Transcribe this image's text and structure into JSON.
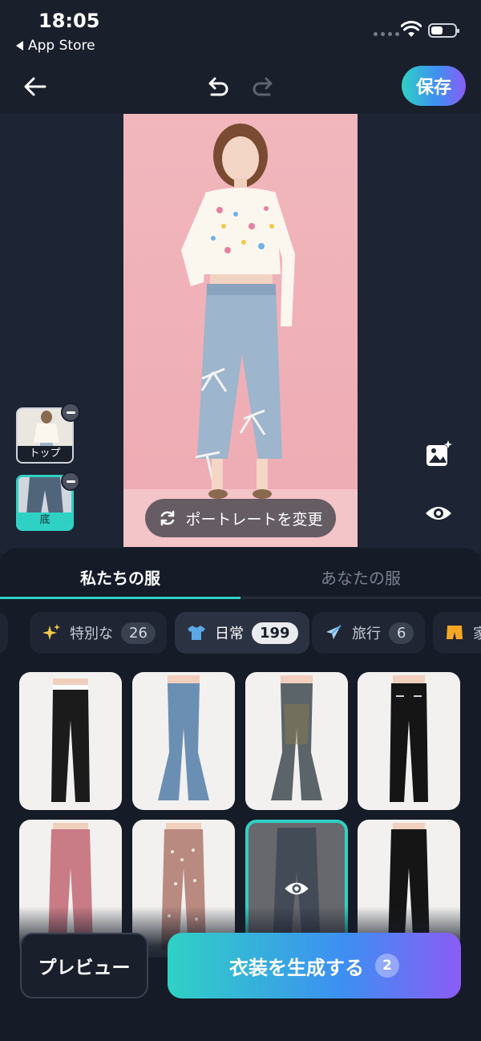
{
  "status_bar": {
    "time": "18:05",
    "back_app": "App Store"
  },
  "header": {
    "save_label": "保存"
  },
  "editor": {
    "change_portrait_label": "ポートレートを変更",
    "layers": [
      {
        "label": "トップ",
        "active": false
      },
      {
        "label": "底",
        "active": true
      }
    ]
  },
  "tabs": [
    {
      "label": "私たちの服",
      "active": true
    },
    {
      "label": "あなたの服",
      "active": false
    }
  ],
  "categories": [
    {
      "label": "特別な",
      "count": "26",
      "icon": "sparkles-icon",
      "selected": false
    },
    {
      "label": "日常",
      "count": "199",
      "icon": "tshirt-icon",
      "selected": true
    },
    {
      "label": "旅行",
      "count": "6",
      "icon": "airplane-icon",
      "selected": false
    },
    {
      "label": "家",
      "count": "",
      "icon": "shorts-icon",
      "selected": false
    }
  ],
  "outfits": [
    {
      "name": "black-wide-pants",
      "selected": false
    },
    {
      "name": "blue-flare-jeans",
      "selected": false
    },
    {
      "name": "gray-flare-jeans",
      "selected": false
    },
    {
      "name": "black-zip-pants",
      "selected": false
    },
    {
      "name": "pink-straight-pants",
      "selected": false
    },
    {
      "name": "dot-print-pants",
      "selected": false
    },
    {
      "name": "ribbon-denim",
      "selected": true
    },
    {
      "name": "black-high-waist-pants",
      "selected": false
    }
  ],
  "actions": {
    "preview_label": "プレビュー",
    "generate_label": "衣装を生成する",
    "generate_count": "2"
  },
  "colors": {
    "accent": "#2fd1c5",
    "background": "#1a1f2c",
    "panel": "#151b27"
  }
}
